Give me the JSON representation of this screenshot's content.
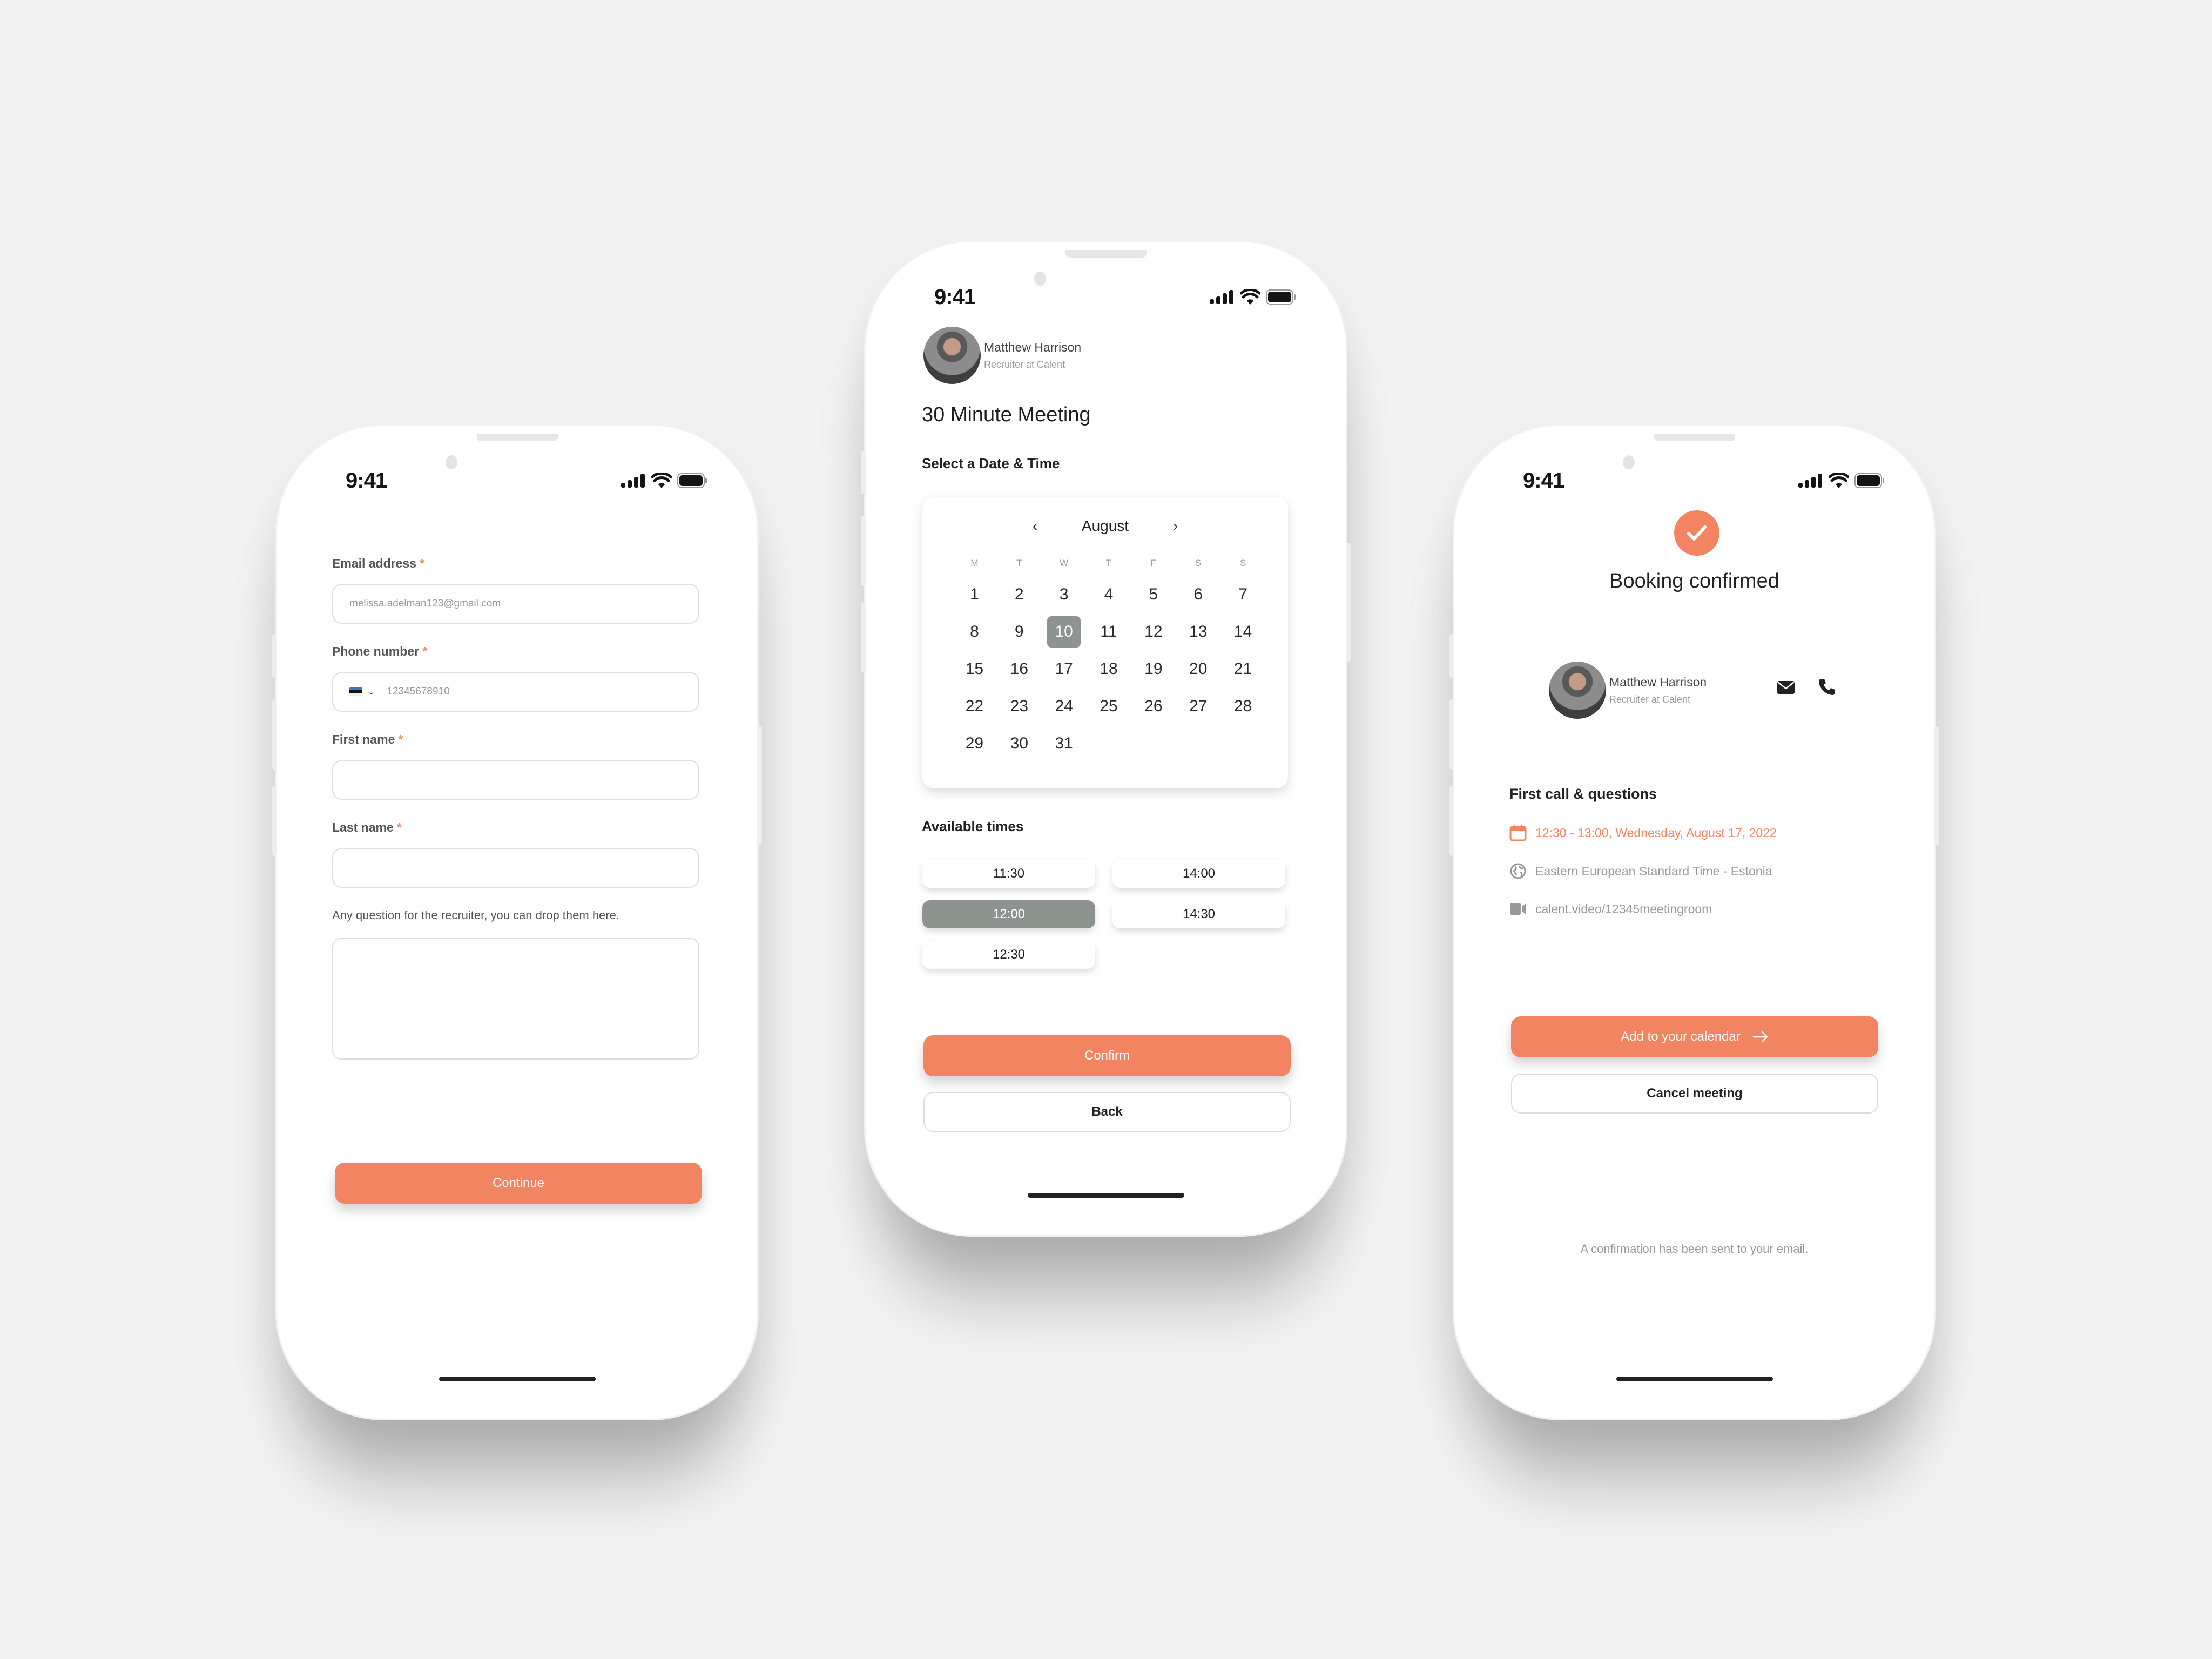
{
  "colors": {
    "accent": "#f28462",
    "selected_gray": "#8d9490",
    "background": "#f3f3f3"
  },
  "status_bar": {
    "time": "9:41",
    "icons": [
      "signal-icon",
      "wifi-icon",
      "battery-icon"
    ]
  },
  "form_screen": {
    "email": {
      "label": "Email address",
      "required_mark": "*",
      "placeholder": "melissa.adelman123@gmail.com"
    },
    "phone": {
      "label": "Phone number",
      "required_mark": "*",
      "country_flag": "estonia-flag",
      "placeholder": "12345678910"
    },
    "first_name": {
      "label": "First name",
      "required_mark": "*",
      "value": ""
    },
    "last_name": {
      "label": "Last name",
      "required_mark": "*",
      "value": ""
    },
    "question": {
      "label": "Any question for the recruiter, you can drop them here.",
      "value": ""
    },
    "continue_label": "Continue"
  },
  "scheduler_screen": {
    "recruiter": {
      "name": "Matthew Harrison",
      "role": "Recruiter at Calent"
    },
    "meeting_title": "30 Minute Meeting",
    "select_label": "Select a Date & Time",
    "calendar": {
      "month": "August",
      "prev_icon": "‹",
      "next_icon": "›",
      "weekdays": [
        "M",
        "T",
        "W",
        "T",
        "F",
        "S",
        "S"
      ],
      "days": [
        "1",
        "2",
        "3",
        "4",
        "5",
        "6",
        "7",
        "8",
        "9",
        "10",
        "11",
        "12",
        "13",
        "14",
        "15",
        "16",
        "17",
        "18",
        "19",
        "20",
        "21",
        "22",
        "23",
        "24",
        "25",
        "26",
        "27",
        "28",
        "29",
        "30",
        "31"
      ],
      "selected_day": "10"
    },
    "available_label": "Available times",
    "times": [
      "11:30",
      "14:00",
      "12:00",
      "14:30",
      "12:30"
    ],
    "selected_time": "12:00",
    "confirm_label": "Confirm",
    "back_label": "Back"
  },
  "confirmation_screen": {
    "title": "Booking confirmed",
    "recruiter": {
      "name": "Matthew Harrison",
      "role": "Recruiter at Calent"
    },
    "event_title": "First call & questions",
    "datetime": "12:30 - 13:00, Wednesday, August 17, 2022",
    "timezone": "Eastern European Standard Time - Estonia",
    "video_link": "calent.video/12345meetingroom",
    "add_calendar_label": "Add to your calendar",
    "cancel_label": "Cancel meeting",
    "footnote": "A confirmation has been sent to your email."
  }
}
